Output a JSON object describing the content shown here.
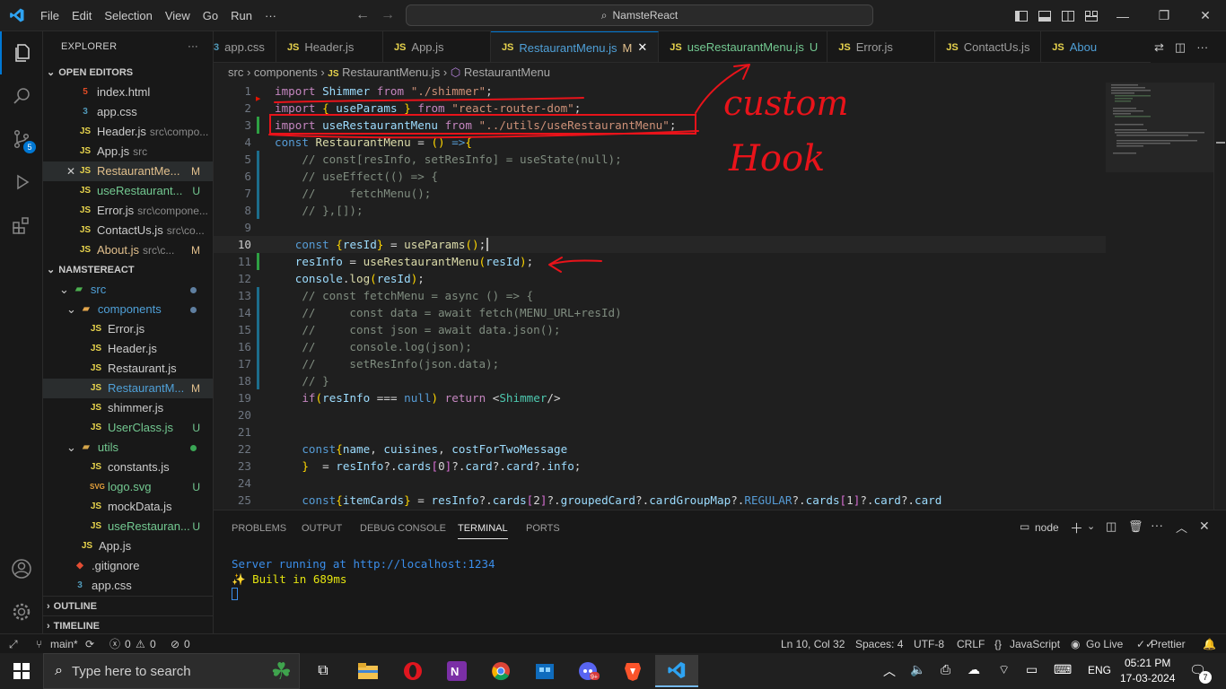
{
  "titlebar": {
    "menu": [
      "File",
      "Edit",
      "Selection",
      "View",
      "Go",
      "Run",
      "···"
    ],
    "search": "NamsteReact"
  },
  "sidebar": {
    "title": "EXPLORER",
    "more": "···",
    "open_editors": "OPEN EDITORS",
    "oe": [
      {
        "icon": "5",
        "name": "index.html",
        "desc": "",
        "badge": ""
      },
      {
        "icon": "3",
        "name": "app.css",
        "desc": "",
        "badge": ""
      },
      {
        "icon": "JS",
        "name": "Header.js",
        "desc": "src\\compo...",
        "badge": ""
      },
      {
        "icon": "JS",
        "name": "App.js",
        "desc": "src",
        "badge": ""
      },
      {
        "icon": "JS",
        "name": "RestaurantMe...",
        "desc": "",
        "badge": "M",
        "close": "✕"
      },
      {
        "icon": "JS",
        "name": "useRestaurant...",
        "desc": "",
        "badge": "U"
      },
      {
        "icon": "JS",
        "name": "Error.js",
        "desc": "src\\compone...",
        "badge": ""
      },
      {
        "icon": "JS",
        "name": "ContactUs.js",
        "desc": "src\\co...",
        "badge": ""
      },
      {
        "icon": "JS",
        "name": "About.js",
        "desc": "src\\c...",
        "badge": "M"
      }
    ],
    "project": "NAMSTEREACT",
    "tree": [
      {
        "name": "src"
      },
      {
        "name": "components"
      },
      {
        "name": "Error.js"
      },
      {
        "name": "Header.js"
      },
      {
        "name": "Restaurant.js"
      },
      {
        "name": "RestaurantM...",
        "badge": "M"
      },
      {
        "name": "shimmer.js"
      },
      {
        "name": "UserClass.js",
        "badge": "U"
      },
      {
        "name": "utils"
      },
      {
        "name": "constants.js"
      },
      {
        "name": "logo.svg",
        "badge": "U"
      },
      {
        "name": "mockData.js"
      },
      {
        "name": "useRestauran...",
        "badge": "U"
      },
      {
        "name": "App.js"
      },
      {
        "name": ".gitignore"
      },
      {
        "name": "app.css"
      }
    ],
    "outline": "OUTLINE",
    "timeline": "TIMELINE"
  },
  "tabs": [
    {
      "icon": "3",
      "label": "app.css",
      "badge": ""
    },
    {
      "icon": "JS",
      "label": "Header.js",
      "badge": ""
    },
    {
      "icon": "JS",
      "label": "App.js",
      "badge": ""
    },
    {
      "icon": "JS",
      "label": "RestaurantMenu.js",
      "badge": "M"
    },
    {
      "icon": "JS",
      "label": "useRestaurantMenu.js",
      "badge": "U"
    },
    {
      "icon": "JS",
      "label": "Error.js",
      "badge": ""
    },
    {
      "icon": "JS",
      "label": "ContactUs.js",
      "badge": ""
    },
    {
      "icon": "JS",
      "label": "Abou",
      "badge": ""
    }
  ],
  "breadcrumb": [
    "src",
    "components",
    "RestaurantMenu.js",
    "RestaurantMenu"
  ],
  "line_numbers": [
    "1",
    "2",
    "3",
    "4",
    "5",
    "6",
    "7",
    "8",
    "9",
    "10",
    "11",
    "12",
    "13",
    "14",
    "15",
    "16",
    "17",
    "18",
    "19",
    "20",
    "21",
    "22",
    "23",
    "24",
    "25"
  ],
  "annotation": {
    "line1": "custom",
    "line2": "Hook"
  },
  "panel": {
    "tabs": [
      "PROBLEMS",
      "OUTPUT",
      "DEBUG CONSOLE",
      "TERMINAL",
      "PORTS"
    ],
    "shell": "node",
    "lines": [
      "Server running at http://localhost:1234",
      "✨ Built in 689ms"
    ]
  },
  "status": {
    "branch": "main*",
    "errors": "0",
    "warnings": "0",
    "ports": "0",
    "position": "Ln 10, Col 32",
    "spaces": "Spaces: 4",
    "encoding": "UTF-8",
    "eol": "CRLF",
    "language": "JavaScript",
    "golive": "Go Live",
    "prettier": "Prettier"
  },
  "taskbar": {
    "search": "Type here to search",
    "time": "05:21 PM",
    "date": "17-03-2024",
    "lang": "ENG",
    "notif": "7"
  },
  "activity_badge": "5"
}
